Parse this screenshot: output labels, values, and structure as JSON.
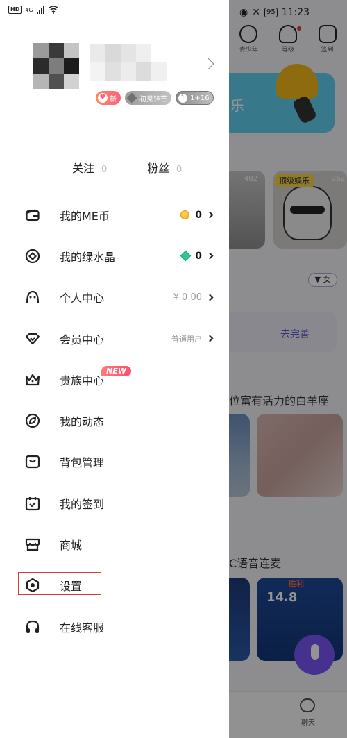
{
  "status_bar": {
    "left": {
      "hd": "HD",
      "network": "4G"
    },
    "right": {
      "battery": "95",
      "time": "11:23"
    }
  },
  "profile": {
    "badges": {
      "new": "新",
      "rank": "初见锋芒",
      "level": "1+16"
    }
  },
  "follow_bar": {
    "following_label": "关注",
    "following_count": "0",
    "fans_label": "粉丝",
    "fans_count": "0"
  },
  "menu": [
    {
      "id": "me-coin",
      "label": "我的ME币",
      "value": "0",
      "icon": "wallet-icon",
      "accessory": "coin"
    },
    {
      "id": "green-crystal",
      "label": "我的绿水晶",
      "value": "0",
      "icon": "crystal-circle-icon",
      "accessory": "crystal"
    },
    {
      "id": "personal-center",
      "label": "个人中心",
      "value": "¥ 0.00",
      "icon": "person-icon"
    },
    {
      "id": "member-center",
      "label": "会员中心",
      "value": "普通用户",
      "icon": "diamond-icon"
    },
    {
      "id": "noble-center",
      "label": "贵族中心",
      "tag": "NEW",
      "icon": "crown-icon"
    },
    {
      "id": "my-moments",
      "label": "我的动态",
      "icon": "leaf-icon"
    },
    {
      "id": "backpack",
      "label": "背包管理",
      "icon": "backpack-icon"
    },
    {
      "id": "check-in",
      "label": "我的签到",
      "icon": "calendar-check-icon"
    },
    {
      "id": "mall",
      "label": "商城",
      "icon": "store-icon"
    },
    {
      "id": "settings",
      "label": "设置",
      "icon": "settings-hex-icon"
    },
    {
      "id": "customer-service",
      "label": "在线客服",
      "icon": "headset-icon"
    }
  ],
  "background": {
    "top_icons": [
      "青少年",
      "等级",
      "签到"
    ],
    "banner_text": "乐",
    "card_badge": "顶级娱乐",
    "card_counts": [
      "402",
      "262"
    ],
    "filter": "女",
    "strip_action": "去完善",
    "section_1": "位富有活力的白羊座",
    "section_2": "C语音连麦",
    "game_number": "14.8",
    "game_banner": "胜利",
    "tab_label": "聊天"
  },
  "colors": {
    "accent_purple": "#7a55f5",
    "highlight_red": "#d93b3b",
    "coin_gold": "#f5a516",
    "crystal_green": "#2ec98f"
  }
}
